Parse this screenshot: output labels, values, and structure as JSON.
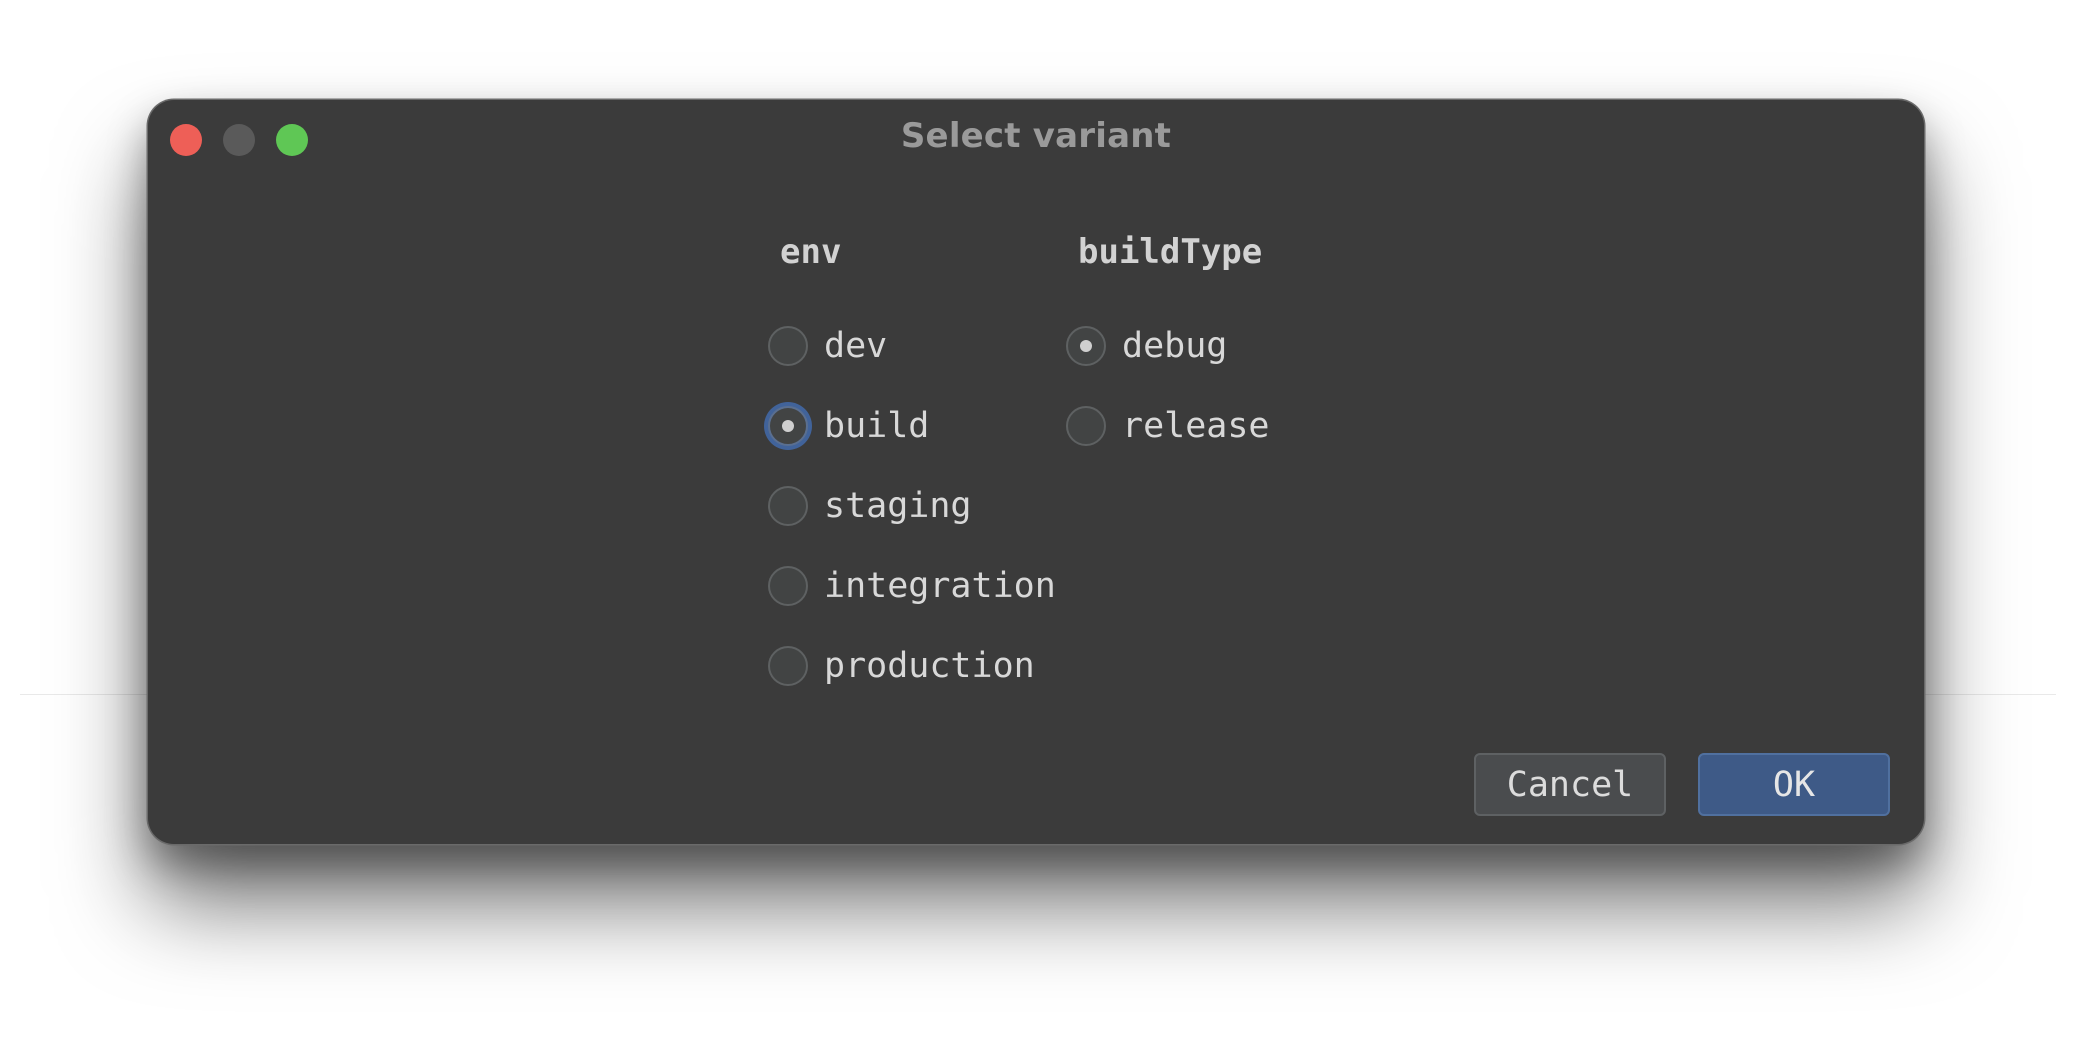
{
  "dialog": {
    "title": "Select variant"
  },
  "env": {
    "header": "env",
    "options": [
      "dev",
      "build",
      "staging",
      "integration",
      "production"
    ],
    "selected": "build"
  },
  "buildType": {
    "header": "buildType",
    "options": [
      "debug",
      "release"
    ],
    "selected": "debug"
  },
  "buttons": {
    "cancel_label": "Cancel",
    "ok_label": "OK"
  },
  "colors": {
    "window_bg": "#3b3b3b",
    "close": "#ee5f57",
    "minimize": "#5a5a5a",
    "maximize": "#5fc755",
    "accent": "#3e5a87"
  }
}
